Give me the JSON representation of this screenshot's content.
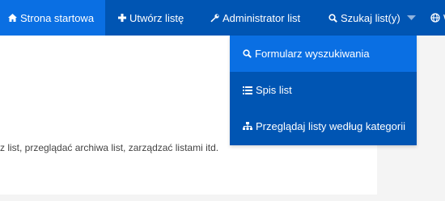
{
  "nav": {
    "items": [
      {
        "label": "Strona startowa",
        "icon": "home-icon"
      },
      {
        "label": "Utwórz listę",
        "icon": "plus-icon"
      },
      {
        "label": "Administrator list",
        "icon": "wrench-icon"
      },
      {
        "label": "Szukaj list(y)",
        "icon": "search-icon"
      },
      {
        "label": "W",
        "icon": "globe-icon"
      }
    ]
  },
  "search_menu": {
    "items": [
      {
        "label": "Formularz wyszukiwania",
        "icon": "search-icon"
      },
      {
        "label": "Spis list",
        "icon": "list-icon"
      },
      {
        "label": "Przeglądaj listy według kategorii",
        "icon": "sitemap-icon"
      }
    ]
  },
  "main": {
    "description_fragment": "z list, przeglądać archiwa list, zarządzać listami itd."
  },
  "colors": {
    "navbar": "#0055b3",
    "active": "#0a6fe3",
    "panel": "#f4f4f4"
  }
}
